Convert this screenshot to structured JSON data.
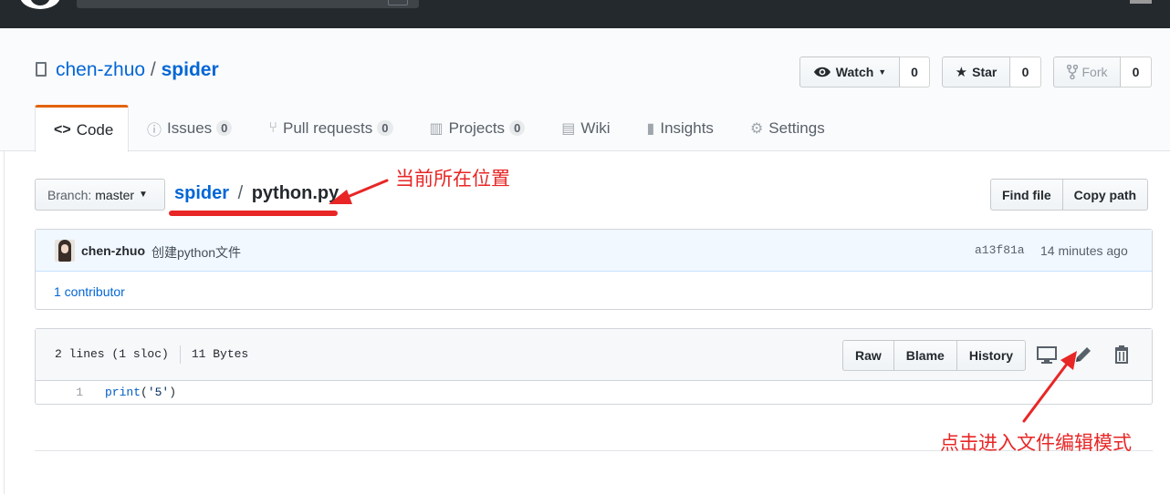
{
  "repo": {
    "owner": "chen-zhuo",
    "separator": "/",
    "name": "spider"
  },
  "actions": {
    "watch_label": "Watch",
    "watch_count": "0",
    "star_label": "Star",
    "star_count": "0",
    "fork_label": "Fork",
    "fork_count": "0"
  },
  "tabs": [
    {
      "label": "Code",
      "counter": ""
    },
    {
      "label": "Issues",
      "counter": "0"
    },
    {
      "label": "Pull requests",
      "counter": "0"
    },
    {
      "label": "Projects",
      "counter": "0"
    },
    {
      "label": "Wiki",
      "counter": ""
    },
    {
      "label": "Insights",
      "counter": ""
    },
    {
      "label": "Settings",
      "counter": ""
    }
  ],
  "breadcrumb": {
    "branch_prefix": "Branch:",
    "branch_name": "master",
    "root": "spider",
    "separator": "/",
    "file": "python.py",
    "find_file": "Find file",
    "copy_path": "Copy path"
  },
  "commit": {
    "author": "chen-zhuo",
    "message": "创建python文件",
    "sha": "a13f81a",
    "time": "14 minutes ago",
    "contributors": "1 contributor"
  },
  "file": {
    "lines_info": "2 lines (1 sloc)",
    "size": "11 Bytes",
    "raw": "Raw",
    "blame": "Blame",
    "history": "History",
    "line_number": "1",
    "code_fn": "print",
    "code_open": "(",
    "code_str": "'5'",
    "code_close": ")"
  },
  "annotations": {
    "location_note": "当前所在位置",
    "edit_note": "点击进入文件编辑模式",
    "color": "#e82626"
  },
  "colors": {
    "link": "#0366d6",
    "tab_accent": "#e36209",
    "header_bg": "#24292e"
  }
}
